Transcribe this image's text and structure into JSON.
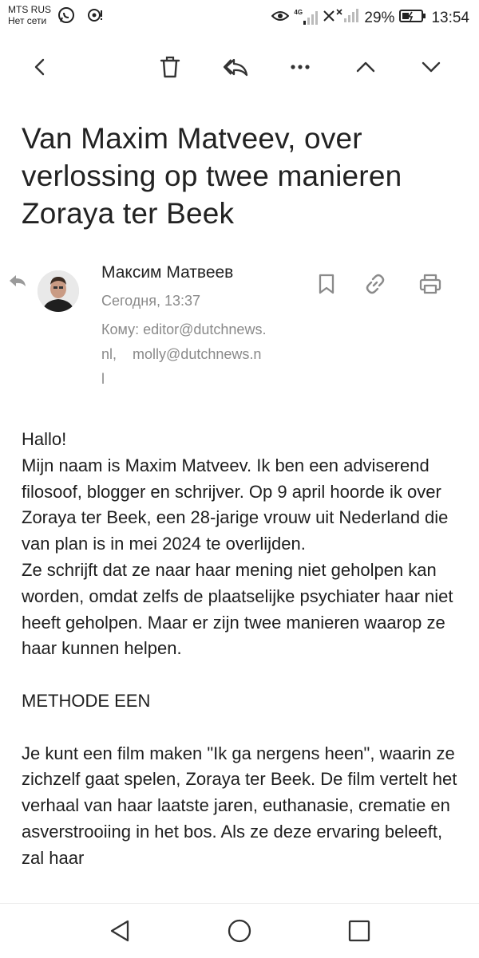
{
  "status_bar": {
    "carrier": "MTS RUS",
    "carrier_sub": "Нет сети",
    "network_label": "4G",
    "battery": "29%",
    "time": "13:54",
    "icons": [
      "whatsapp-icon",
      "sync-alert-icon",
      "eye-icon",
      "signal-icon",
      "no-signal-icon",
      "battery-icon"
    ]
  },
  "toolbar": {
    "icons": [
      "back-icon",
      "trash-icon",
      "reply-all-icon",
      "more-icon",
      "previous-icon",
      "next-icon"
    ]
  },
  "message": {
    "subject": "Van Maxim Matveev, over verlossing op twee manieren Zoraya ter Beek",
    "sender_name": "Максим Матвеев",
    "date": "Сегодня, 13:37",
    "to_label": "Кому:",
    "to_line1": "editor@dutchnews.",
    "to_line2": "nl,",
    "to_line2b": "molly@dutchnews.n",
    "to_line3": "l",
    "actions": [
      "bookmark-icon",
      "link-icon",
      "print-icon"
    ]
  },
  "body": {
    "p1": "Hallo!",
    "p2": "Mijn naam is Maxim Matveev. Ik ben een adviserend filosoof, blogger en schrijver. Op 9 april hoorde ik over Zoraya ter Beek, een 28-jarige vrouw uit Nederland die van plan is in mei 2024 te overlijden.",
    "p3": "Ze schrijft dat ze naar haar mening niet geholpen kan worden, omdat zelfs de plaatselijke psychiater haar niet heeft geholpen. Maar er zijn twee manieren waarop ze haar kunnen helpen.",
    "p4": "METHODE EEN",
    "p5": "Je kunt een film maken \"Ik ga nergens heen\", waarin ze zichzelf gaat spelen, Zoraya ter Beek. De film vertelt het verhaal van haar laatste jaren, euthanasie, crematie en asverstrooiing in het bos. Als ze deze ervaring beleeft, zal haar"
  },
  "navbar": {
    "icons": [
      "nav-back-icon",
      "nav-home-icon",
      "nav-recents-icon"
    ]
  },
  "colors": {
    "text": "#1e1e1e",
    "secondary": "#8a8a8a",
    "icon": "#333333",
    "icon_light": "#8a8a8a"
  }
}
